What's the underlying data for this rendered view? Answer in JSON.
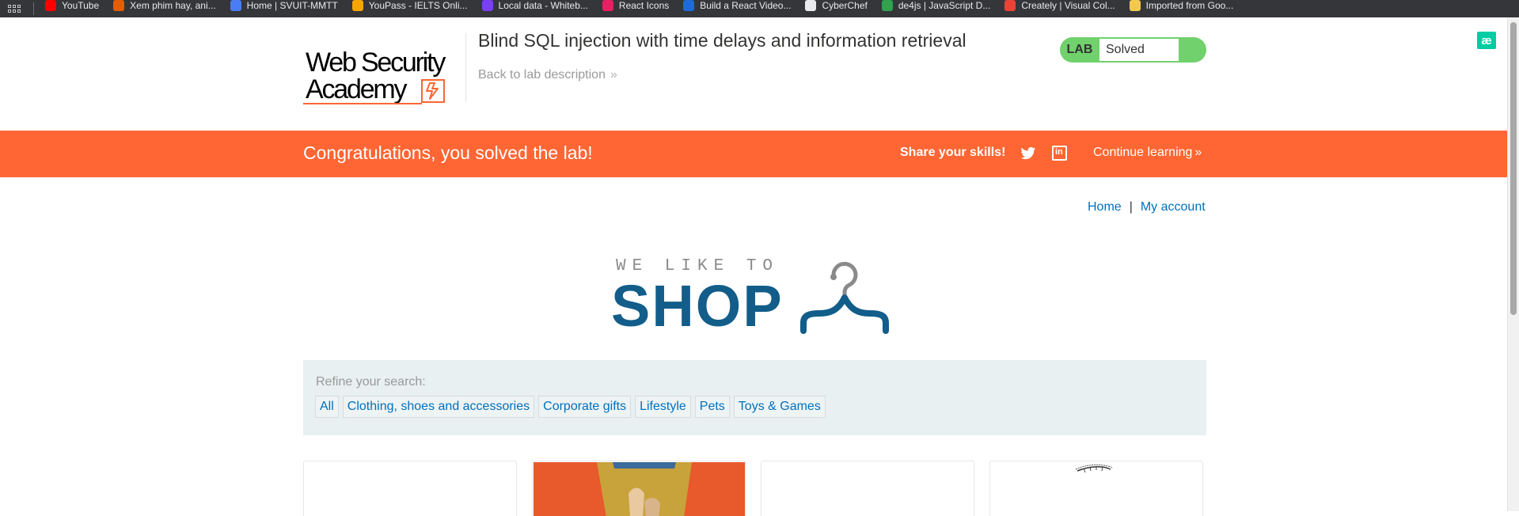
{
  "bookmarks": [
    {
      "label": "YouTube",
      "color": "#ff0000"
    },
    {
      "label": "Xem phim hay, ani...",
      "color": "#e65c00"
    },
    {
      "label": "Home | SVUIT-MMTT",
      "color": "#4a7cf5"
    },
    {
      "label": "YouPass - IELTS Onli...",
      "color": "#f7a600"
    },
    {
      "label": "Local data - Whiteb...",
      "color": "#7b3ff2"
    },
    {
      "label": "React Icons",
      "color": "#e91e63"
    },
    {
      "label": "Build a React Video...",
      "color": "#1e6bd6"
    },
    {
      "label": "CyberChef",
      "color": "#e8eaed"
    },
    {
      "label": "de4js | JavaScript D...",
      "color": "#2ea44f"
    },
    {
      "label": "Creately | Visual Col...",
      "color": "#ea4335"
    },
    {
      "label": "Imported from Goo...",
      "color": "#f2c94c"
    }
  ],
  "header": {
    "logo_line1": "Web Security",
    "logo_line2": "Academy",
    "lab_title": "Blind SQL injection with time delays and information retrieval",
    "back_link": "Back to lab description",
    "lab_tag": "LAB",
    "lab_state": "Solved",
    "ae_icon": "æ"
  },
  "notification": {
    "message": "Congratulations, you solved the lab!",
    "share_label": "Share your skills!",
    "continue_label": "Continue learning"
  },
  "nav": {
    "home": "Home",
    "separator": "|",
    "account": "My account"
  },
  "shop_logo": {
    "small_text": "WE LIKE TO",
    "big_text": "SHOP"
  },
  "filters": {
    "label": "Refine your search:",
    "items": [
      "All",
      "Clothing, shoes and accessories",
      "Corporate gifts",
      "Lifestyle",
      "Pets",
      "Toys & Games"
    ]
  },
  "colors": {
    "brand_orange": "#ff6633",
    "lab_solved_green": "#70d16d",
    "link_blue": "#0071bc",
    "shop_blue": "#125d8a"
  }
}
